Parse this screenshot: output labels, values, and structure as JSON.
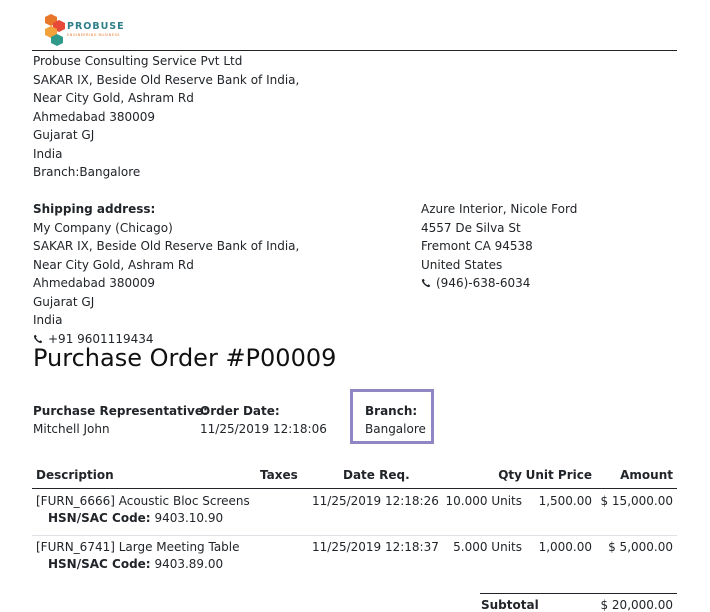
{
  "logo": {
    "text": "PROBUSE",
    "tagline": "ENGINEERING BUSINESS"
  },
  "company": {
    "lines": [
      "Probuse Consulting Service Pvt Ltd",
      "SAKAR IX, Beside Old Reserve Bank of India,",
      "Near City Gold, Ashram Rd",
      "Ahmedabad 380009",
      "Gujarat GJ",
      "India",
      "Branch:Bangalore"
    ]
  },
  "shipping": {
    "label": "Shipping address:",
    "lines": [
      "My Company (Chicago)",
      "SAKAR IX, Beside Old Reserve Bank of India,",
      "Near City Gold, Ashram Rd",
      "Ahmedabad 380009",
      "Gujarat GJ",
      "India"
    ],
    "phone": "+91 9601119434"
  },
  "customer": {
    "lines": [
      "Azure Interior, Nicole Ford",
      "4557 De Silva St",
      "Fremont CA 94538",
      "United States"
    ],
    "phone": "(946)-638-6034"
  },
  "title": "Purchase Order #P00009",
  "info": {
    "rep_label": "Purchase Representative:",
    "rep_value": "Mitchell John",
    "date_label": "Order Date:",
    "date_value": "11/25/2019 12:18:06",
    "branch_label": "Branch:",
    "branch_value": "Bangalore"
  },
  "table": {
    "headers": {
      "description": "Description",
      "taxes": "Taxes",
      "date_req": "Date Req.",
      "qty": "Qty",
      "unit_price": "Unit Price",
      "amount": "Amount"
    },
    "rows": [
      {
        "description": "[FURN_6666] Acoustic Bloc Screens",
        "hsn_label": "HSN/SAC Code:",
        "hsn_value": "9403.10.90",
        "taxes": "",
        "date_req": "11/25/2019 12:18:26",
        "qty": "10.000 Units",
        "unit_price": "1,500.00",
        "amount": "$ 15,000.00"
      },
      {
        "description": "[FURN_6741] Large Meeting Table",
        "hsn_label": "HSN/SAC Code:",
        "hsn_value": "9403.89.00",
        "taxes": "",
        "date_req": "11/25/2019 12:18:37",
        "qty": "5.000 Units",
        "unit_price": "1,000.00",
        "amount": "$ 5,000.00"
      }
    ]
  },
  "totals": {
    "subtotal_label": "Subtotal",
    "subtotal_value": "$ 20,000.00"
  },
  "colors": {
    "branch_highlight": "#8e87c4",
    "logo_teal": "#2f7f8a",
    "logo_orange": "#e8762b"
  }
}
